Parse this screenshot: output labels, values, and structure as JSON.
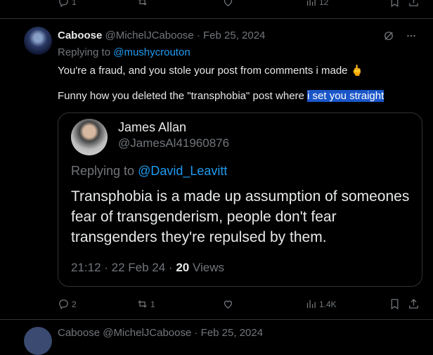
{
  "top_actions": {
    "replies": "1",
    "views": "12"
  },
  "tweet": {
    "display_name": "Caboose",
    "handle": "@MichelJCaboose",
    "separator": " · ",
    "date": "Feb 25, 2024",
    "replying_prefix": "Replying to ",
    "replying_to": "@mushycrouton",
    "text_line1": "You're a fraud, and you stole your post from comments i made",
    "text_line2_prefix": "Funny how you deleted the \"transphobia\" post where ",
    "text_line2_highlight": "i set you straight"
  },
  "quote": {
    "display_name": "James Allan",
    "handle": "@JamesAl41960876",
    "replying_prefix": "Replying to ",
    "replying_to": "@David_Leavitt",
    "text_line1": "Transphobia is a made up assumption of someones",
    "text_line2": "fear of transgenderism, people don't fear",
    "text_line3": "transgenders they're repulsed by them.",
    "time": "21:12 · 22 Feb 24 · ",
    "views_count": "20",
    "views_label": " Views"
  },
  "actions": {
    "replies": "2",
    "reposts": "1",
    "views": "1.4K"
  },
  "next_tweet": {
    "preview": "Caboose  @MichelJCaboose · Feb 25, 2024"
  }
}
